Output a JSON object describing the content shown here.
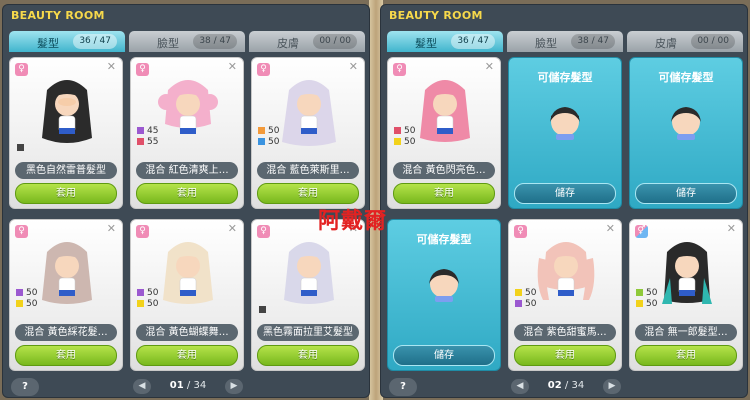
{
  "panels": [
    {
      "title": "BEAUTY ROOM",
      "tabs": [
        {
          "label": "髮型",
          "count": "36 / 47"
        },
        {
          "label": "臉型",
          "count": "38 / 47"
        },
        {
          "label": "皮膚",
          "count": "00 / 00"
        }
      ],
      "cards": [
        {
          "name": "黑色自然雷普髮型",
          "button": "套用",
          "mix": [],
          "hair_color": "#2b2b2b"
        },
        {
          "name": "混合 紅色清爽上…",
          "button": "套用",
          "mix": [
            {
              "color": "#9b59d0",
              "value": "45"
            },
            {
              "color": "#e0506a",
              "value": "55"
            }
          ],
          "hair_color": "#f4b0cc"
        },
        {
          "name": "混合 藍色萊斯里…",
          "button": "套用",
          "mix": [
            {
              "color": "#f39a3a",
              "value": "50"
            },
            {
              "color": "#3a93e0",
              "value": "50"
            }
          ],
          "hair_color": "#dcd6ea"
        },
        {
          "name": "混合 黃色綵花髮…",
          "button": "套用",
          "mix": [
            {
              "color": "#9b59d0",
              "value": "50"
            },
            {
              "color": "#f2d21b",
              "value": "50"
            }
          ],
          "hair_color": "#cdb7b0"
        },
        {
          "name": "混合 黃色蝴蝶舞…",
          "button": "套用",
          "mix": [
            {
              "color": "#9b59d0",
              "value": "50"
            },
            {
              "color": "#f2d21b",
              "value": "50"
            }
          ],
          "hair_color": "#f1e2c9"
        },
        {
          "name": "黑色霧面拉里艾髮型",
          "button": "套用",
          "mix": [],
          "hair_color": "#d9d8ea"
        }
      ],
      "pager": {
        "current": "01",
        "total": "34"
      },
      "help": "?"
    },
    {
      "title": "BEAUTY ROOM",
      "tabs": [
        {
          "label": "髮型",
          "count": "36 / 47"
        },
        {
          "label": "臉型",
          "count": "38 / 47"
        },
        {
          "label": "皮膚",
          "count": "00 / 00"
        }
      ],
      "cards": [
        {
          "name": "混合 黃色閃亮色…",
          "button": "套用",
          "mix": [
            {
              "color": "#e0506a",
              "value": "50"
            },
            {
              "color": "#f2d21b",
              "value": "50"
            }
          ],
          "hair_color": "#ef8aa7"
        },
        {
          "storable_title": "可儲存髮型",
          "button": "儲存"
        },
        {
          "storable_title": "可儲存髮型",
          "button": "儲存"
        },
        {
          "storable_title": "可儲存髮型",
          "button": "儲存"
        },
        {
          "name": "混合 紫色甜蜜馬…",
          "button": "套用",
          "mix": [
            {
              "color": "#f2d21b",
              "value": "50"
            },
            {
              "color": "#9b59d0",
              "value": "50"
            }
          ],
          "hair_color": "#f2c3b9"
        },
        {
          "name": "混合 無一郎髮型…",
          "button": "套用",
          "mix": [
            {
              "color": "#8fc93a",
              "value": "50"
            },
            {
              "color": "#f2d21b",
              "value": "50"
            }
          ],
          "hair_color": "#2a2a2a"
        }
      ],
      "pager": {
        "current": "02",
        "total": "34"
      },
      "help": "?"
    }
  ],
  "watermark": "阿戴爾",
  "colors": {
    "accent": "#41b5cd",
    "apply": "#78b81d",
    "panel": "#3e4a55"
  }
}
